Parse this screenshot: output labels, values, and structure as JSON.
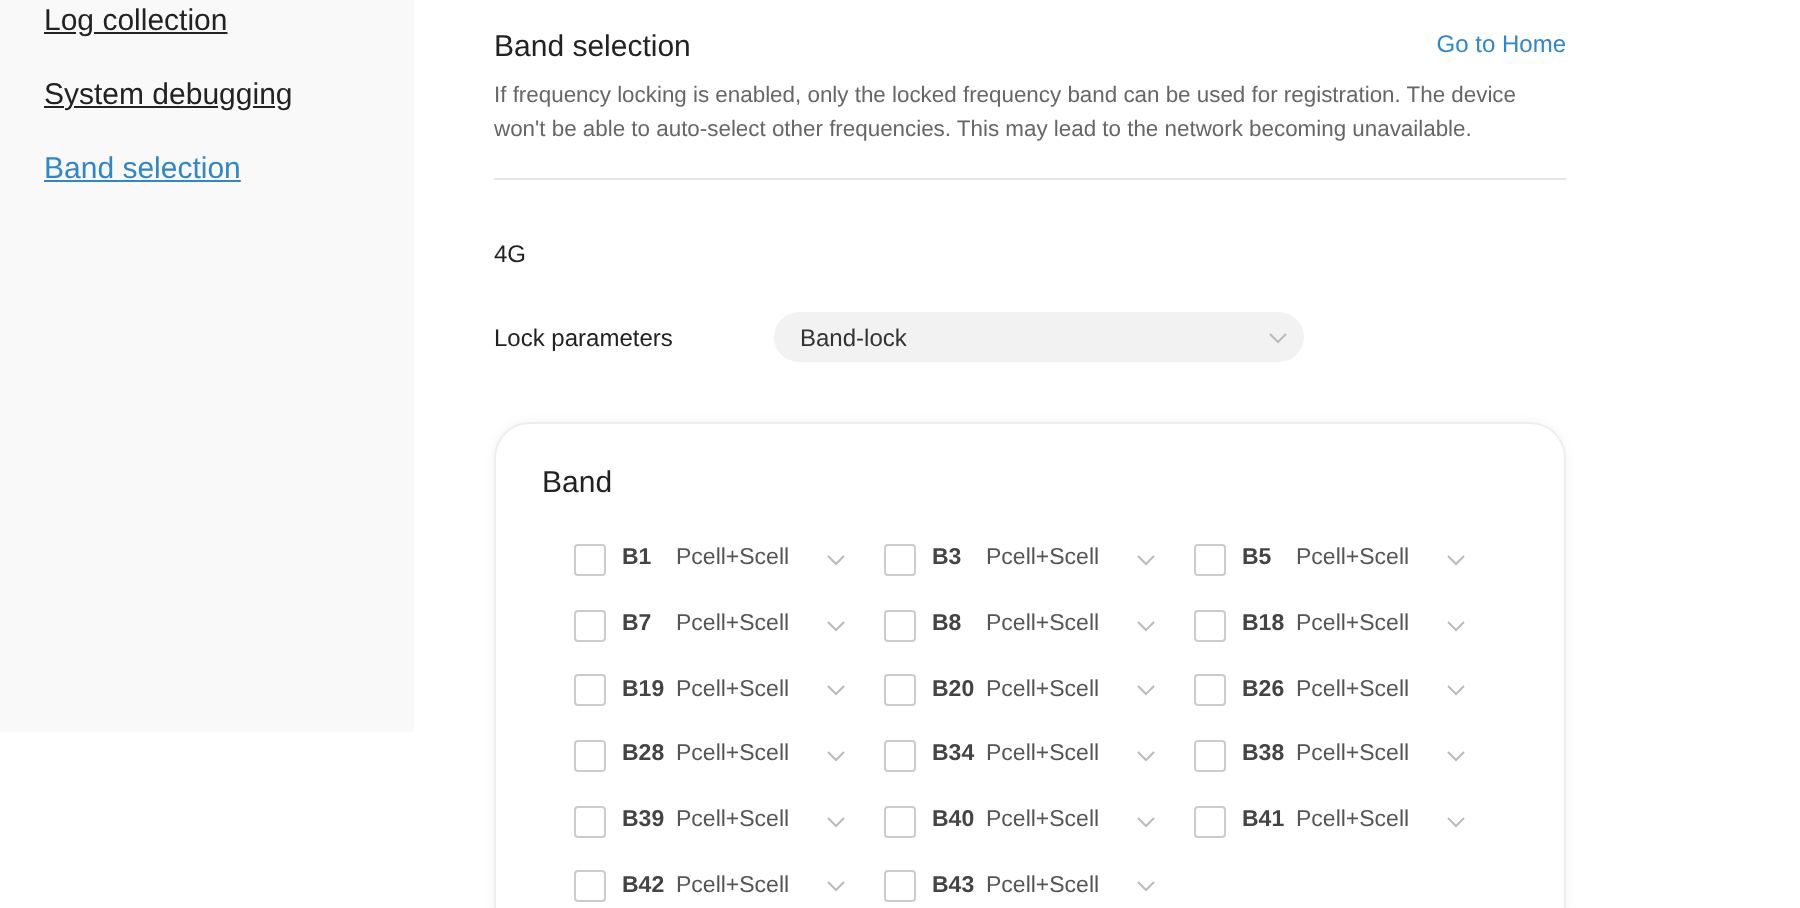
{
  "sidebar": {
    "items": [
      {
        "label": "Log collection",
        "selected": false
      },
      {
        "label": "System debugging",
        "selected": false
      },
      {
        "label": "Band selection",
        "selected": true
      }
    ]
  },
  "header": {
    "title": "Band selection",
    "home_link": "Go to Home"
  },
  "description": "If frequency locking is enabled, only the locked frequency band can be used for registration. The device won't be able to auto-select other frequencies. This may lead to the network becoming unavailable.",
  "network": "4G",
  "lock_parameters": {
    "label": "Lock parameters",
    "value": "Band-lock"
  },
  "band_panel": {
    "title": "Band",
    "bands": [
      {
        "name": "B1",
        "mode": "Pcell+Scell",
        "checked": false
      },
      {
        "name": "B3",
        "mode": "Pcell+Scell",
        "checked": false
      },
      {
        "name": "B5",
        "mode": "Pcell+Scell",
        "checked": false
      },
      {
        "name": "B7",
        "mode": "Pcell+Scell",
        "checked": false
      },
      {
        "name": "B8",
        "mode": "Pcell+Scell",
        "checked": false
      },
      {
        "name": "B18",
        "mode": "Pcell+Scell",
        "checked": false
      },
      {
        "name": "B19",
        "mode": "Pcell+Scell",
        "checked": false
      },
      {
        "name": "B20",
        "mode": "Pcell+Scell",
        "checked": false
      },
      {
        "name": "B26",
        "mode": "Pcell+Scell",
        "checked": false
      },
      {
        "name": "B28",
        "mode": "Pcell+Scell",
        "checked": false
      },
      {
        "name": "B34",
        "mode": "Pcell+Scell",
        "checked": false
      },
      {
        "name": "B38",
        "mode": "Pcell+Scell",
        "checked": false
      },
      {
        "name": "B39",
        "mode": "Pcell+Scell",
        "checked": false
      },
      {
        "name": "B40",
        "mode": "Pcell+Scell",
        "checked": false
      },
      {
        "name": "B41",
        "mode": "Pcell+Scell",
        "checked": false
      },
      {
        "name": "B42",
        "mode": "Pcell+Scell",
        "checked": false
      },
      {
        "name": "B43",
        "mode": "Pcell+Scell",
        "checked": false
      }
    ]
  }
}
